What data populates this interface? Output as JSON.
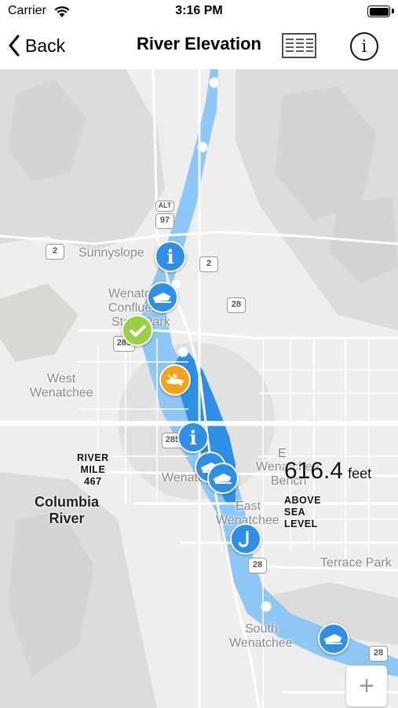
{
  "status": {
    "carrier": "Carrier",
    "time": "3:16 PM"
  },
  "nav": {
    "back_label": "Back",
    "title": "River Elevation",
    "info_label": "i"
  },
  "map": {
    "places": [
      "Sunnyslope",
      "Wenatchee",
      "Confluence",
      "State Park",
      "West",
      "Wenatchee",
      "Wenatchee",
      "Wenatchee",
      "Bench",
      "East",
      "Wenatchee",
      "Terrace Park",
      "South",
      "Wenatchee",
      "Columbia River",
      "E"
    ],
    "highways": [
      "ALT",
      "97",
      "2",
      "2",
      "285",
      "285",
      "28",
      "28",
      "28"
    ],
    "marker_symbols": {
      "info": "i"
    }
  },
  "overlay": {
    "mile_line1": "RIVER",
    "mile_line2": "MILE",
    "mile_number": "467",
    "river_line1": "Columbia",
    "river_line2": "River",
    "elevation_value": "616.4",
    "elevation_unit": "feet",
    "caption_line1": "ABOVE",
    "caption_line2": "SEA",
    "caption_line3": "LEVEL"
  },
  "zoom": {
    "label": "+"
  },
  "colors": {
    "water": "#8ec7f6",
    "river_highlight": "#2f8fe6",
    "marker_orange": "#f2a31b",
    "marker_green": "#9ad045"
  }
}
